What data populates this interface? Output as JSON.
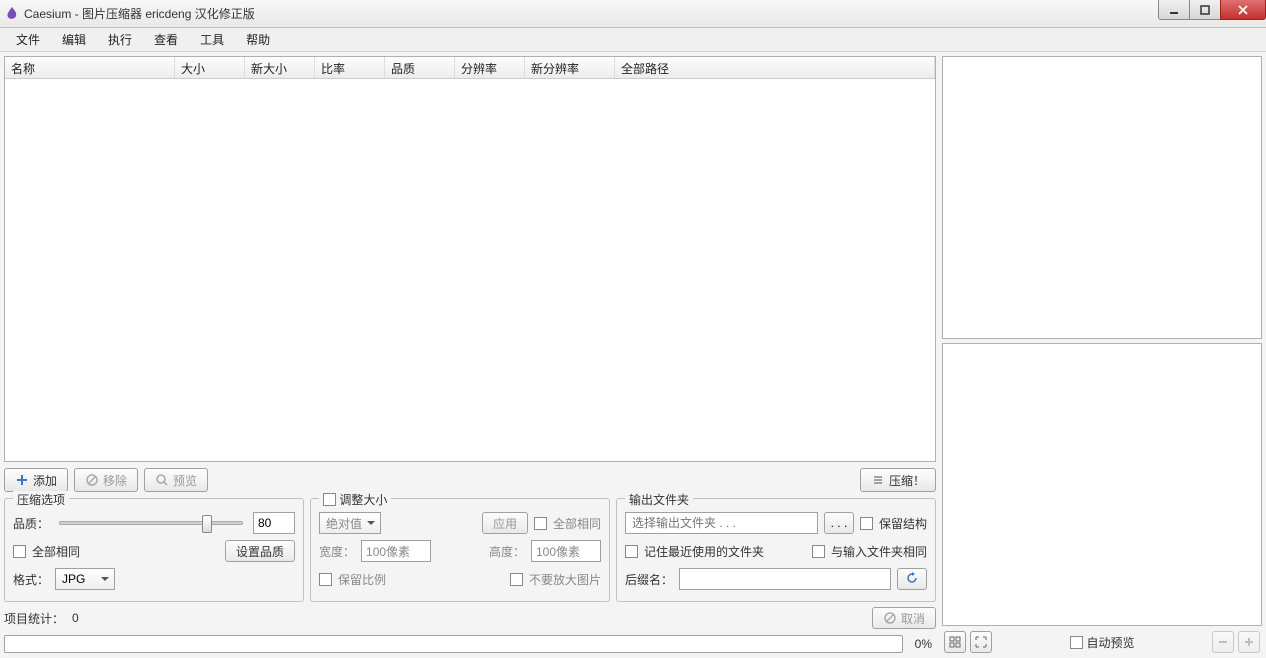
{
  "window": {
    "title": "Caesium - 图片压缩器  ericdeng 汉化修正版"
  },
  "menu": {
    "file": "文件",
    "edit": "编辑",
    "action": "执行",
    "view": "查看",
    "tools": "工具",
    "help": "帮助"
  },
  "table": {
    "headers": {
      "name": "名称",
      "size": "大小",
      "newsize": "新大小",
      "ratio": "比率",
      "quality": "品质",
      "res": "分辨率",
      "newres": "新分辨率",
      "path": "全部路径"
    }
  },
  "toolbar": {
    "add": "添加",
    "remove": "移除",
    "preview": "预览",
    "compress": "压缩！"
  },
  "compress_group": {
    "legend": "压缩选项",
    "quality_label": "品质：",
    "quality_value": "80",
    "same_all": "全部相同",
    "set_quality": "设置品质",
    "format_label": "格式：",
    "format_value": "JPG"
  },
  "resize_group": {
    "legend_check": "调整大小",
    "mode": "绝对值",
    "apply": "应用",
    "same_all": "全部相同",
    "width_label": "宽度：",
    "width_value": "100像素",
    "height_label": "高度：",
    "height_value": "100像素",
    "keep_ratio": "保留比例",
    "no_enlarge": "不要放大图片"
  },
  "output_group": {
    "legend": "输出文件夹",
    "placeholder": "选择输出文件夹 . . .",
    "browse": ". . .",
    "keep_structure": "保留结构",
    "remember": "记住最近使用的文件夹",
    "same_as_input": "与输入文件夹相同",
    "suffix_label": "后缀名：",
    "suffix_value": ""
  },
  "status": {
    "label": "项目统计：",
    "count": "0",
    "cancel": "取消",
    "percent": "0%"
  },
  "right": {
    "auto_preview": "自动预览"
  }
}
